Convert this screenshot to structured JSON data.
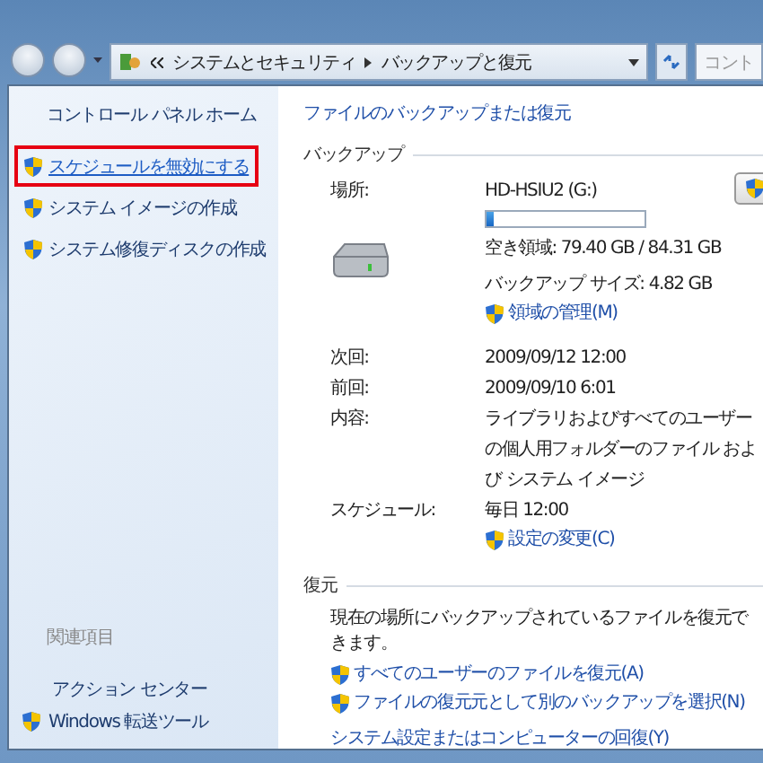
{
  "address_bar": {
    "crumbs": [
      "システムとセキュリティ",
      "バックアップと復元"
    ]
  },
  "search": {
    "placeholder": "コント"
  },
  "sidebar": {
    "home": "コントロール パネル ホーム",
    "tasks": [
      {
        "label": "スケジュールを無効にする",
        "highlighted": true
      },
      {
        "label": "システム イメージの作成",
        "highlighted": false
      },
      {
        "label": "システム修復ディスクの作成",
        "highlighted": false
      }
    ],
    "related_heading": "関連項目",
    "related": [
      {
        "label": "アクション センター",
        "shield": false
      },
      {
        "label": "Windows 転送ツール",
        "shield": true
      }
    ]
  },
  "content": {
    "top_link": "ファイルのバックアップまたは復元",
    "backup": {
      "heading": "バックアップ",
      "location_label": "場所:",
      "location": "HD-HSIU2 (G:)",
      "level": 0.05,
      "free_space": "空き領域: 79.40 GB / 84.31 GB",
      "backup_size": "バックアップ サイズ: 4.82 GB",
      "manage_link": "領域の管理(M)",
      "details": [
        {
          "label": "次回:",
          "value": "2009/09/12 12:00"
        },
        {
          "label": "前回:",
          "value": "2009/09/10 6:01"
        },
        {
          "label": "内容:",
          "value": "ライブラリおよびすべてのユーザーの個人用フォルダーのファイル および システム イメージ"
        },
        {
          "label": "スケジュール:",
          "value": "毎日 12:00"
        }
      ],
      "change_link": "設定の変更(C)"
    },
    "restore": {
      "heading": "復元",
      "description": "現在の場所にバックアップされているファイルを復元できます。",
      "links": [
        {
          "label": "すべてのユーザーのファイルを復元(A)",
          "shield": true
        },
        {
          "label": "ファイルの復元元として別のバックアップを選択(N)",
          "shield": true
        }
      ],
      "bottom_link": "システム設定またはコンピューターの回復(Y)"
    }
  }
}
